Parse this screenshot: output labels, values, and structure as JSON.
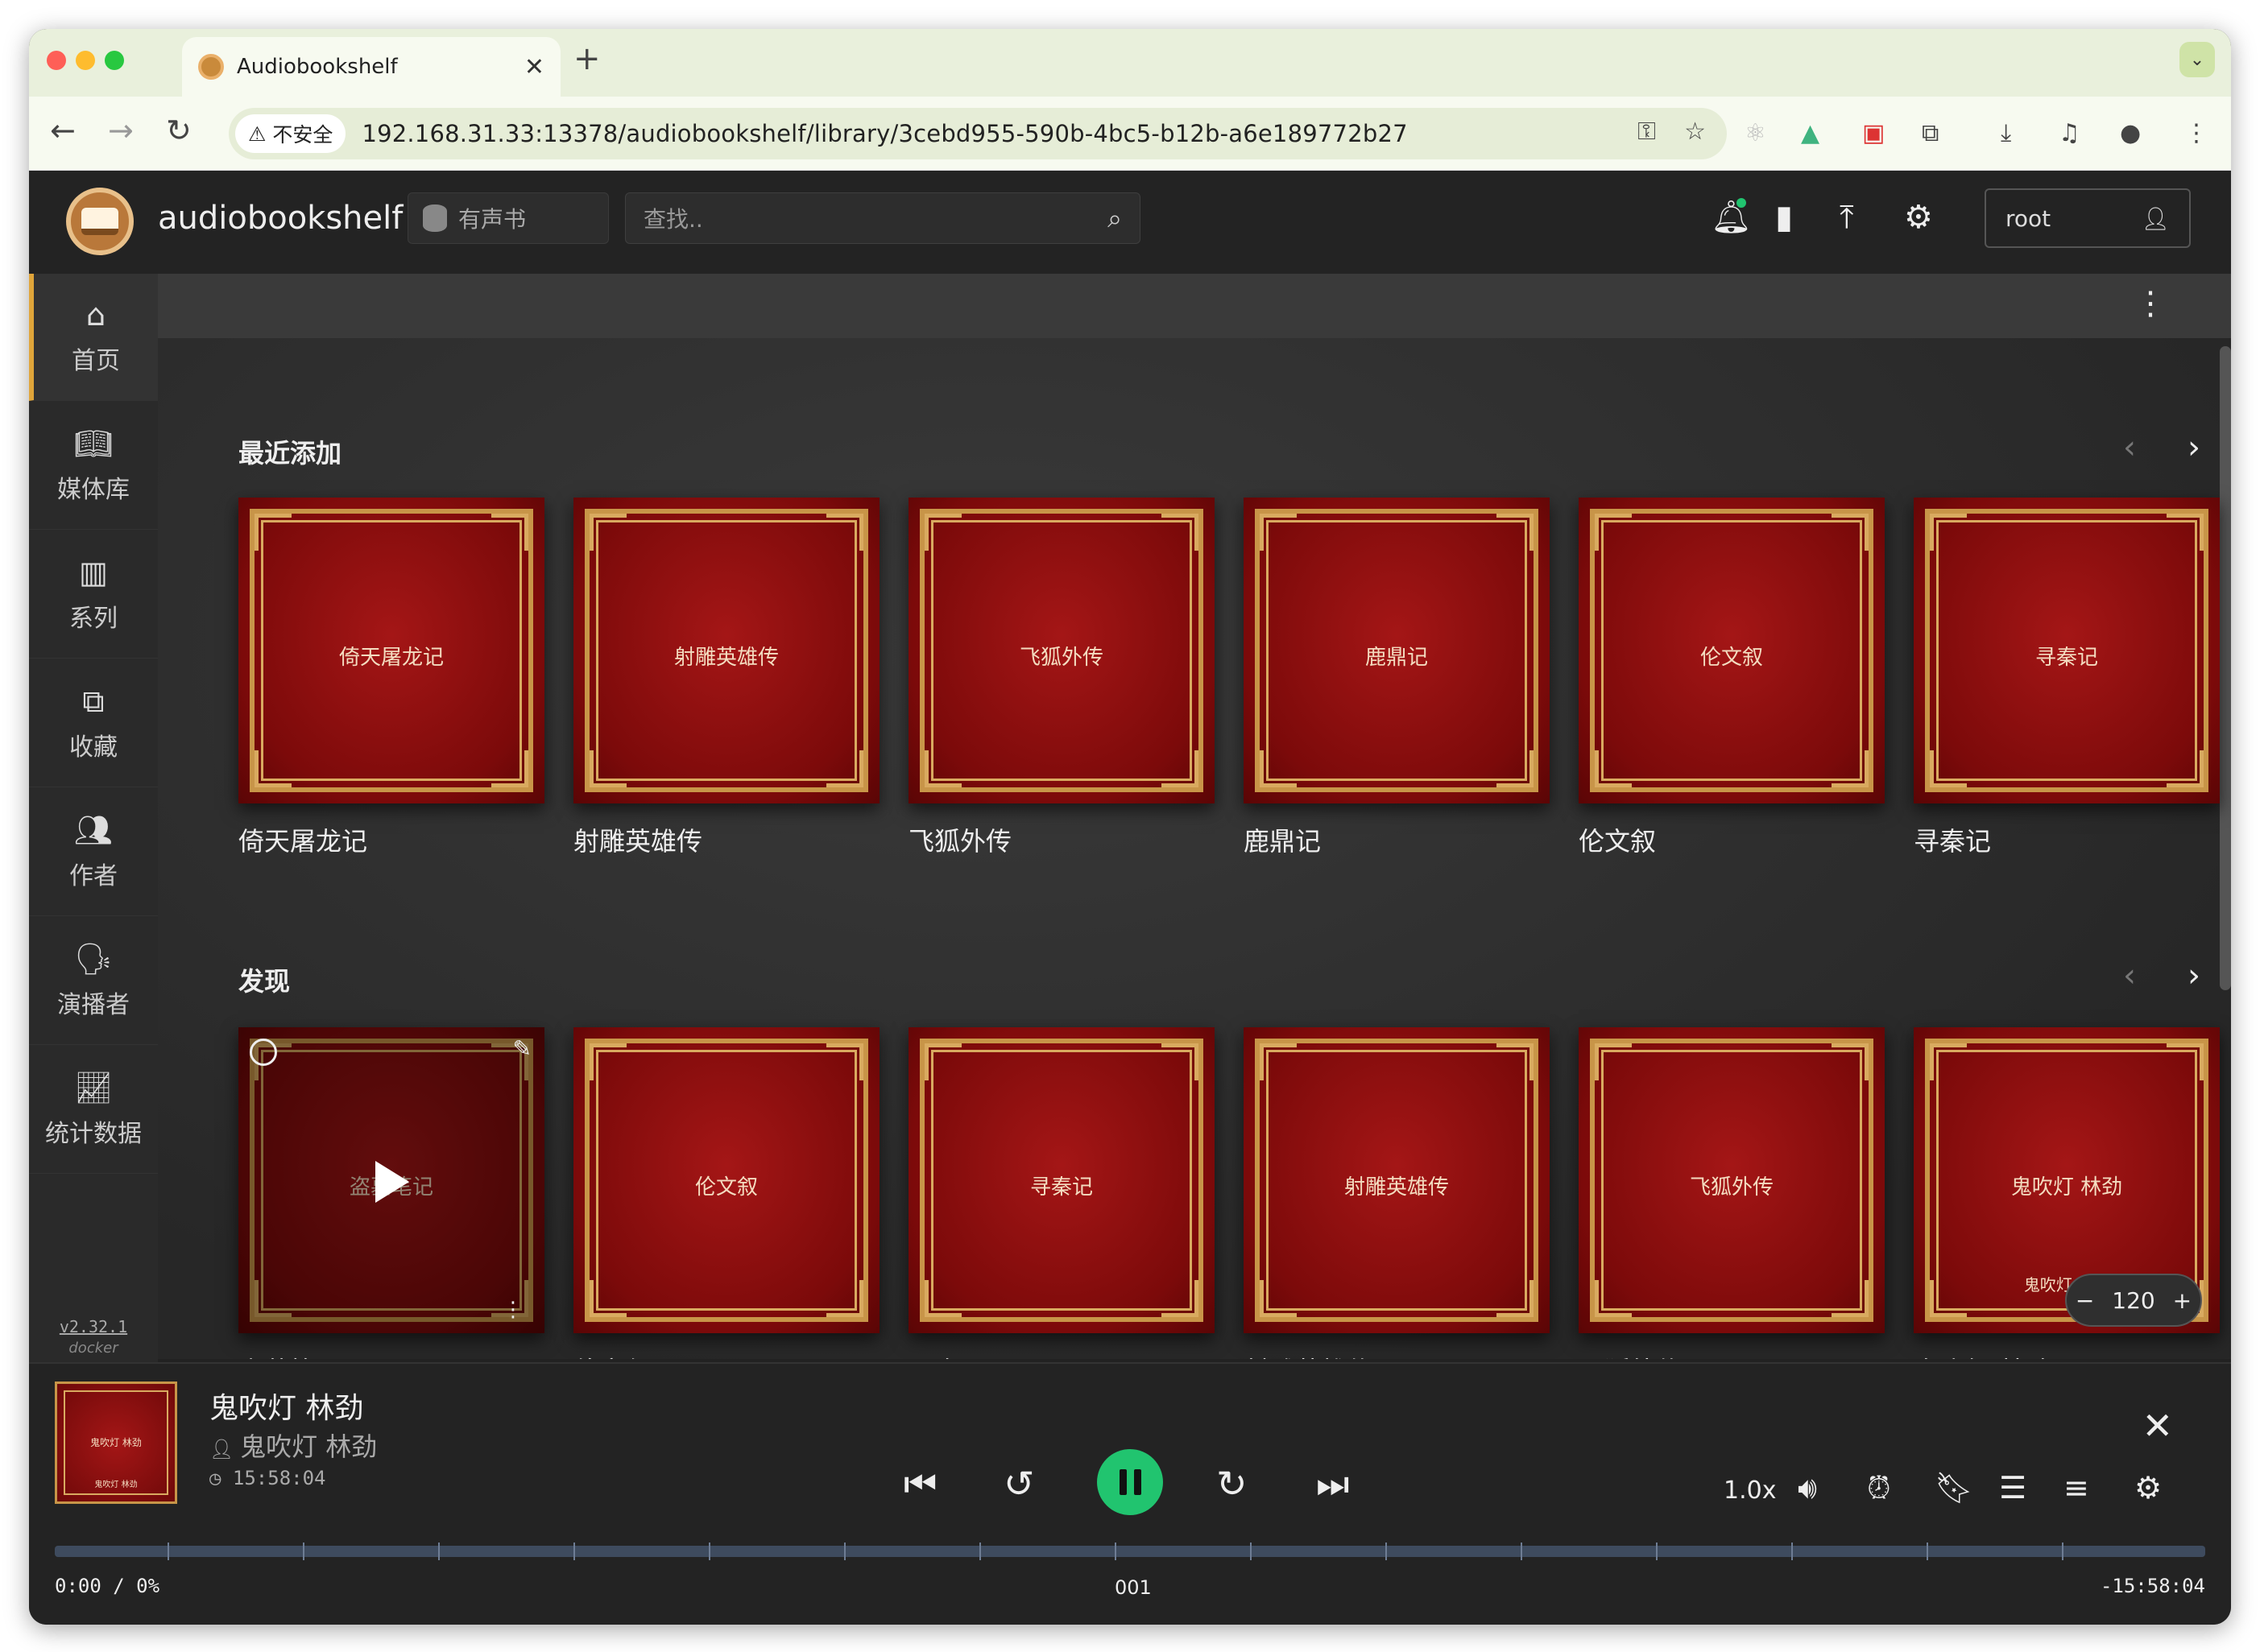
{
  "browser": {
    "tab_title": "Audiobookshelf",
    "new_tab": "+",
    "security_label": "不安全",
    "url": "192.168.31.33:13378/audiobookshelf/library/3cebd955-590b-4bc5-b12b-a6e189772b27"
  },
  "header": {
    "brand": "audiobookshelf",
    "library": "有声书",
    "search_placeholder": "查找..",
    "user": "root"
  },
  "sidebar": {
    "items": [
      {
        "label": "首页",
        "icon": "home-icon"
      },
      {
        "label": "媒体库",
        "icon": "book-open-icon"
      },
      {
        "label": "系列",
        "icon": "columns-icon"
      },
      {
        "label": "收藏",
        "icon": "collections-icon"
      },
      {
        "label": "作者",
        "icon": "users-icon"
      },
      {
        "label": "演播者",
        "icon": "narrator-icon"
      },
      {
        "label": "统计数据",
        "icon": "stats-icon"
      }
    ],
    "version": "v2.32.1",
    "install": "docker"
  },
  "shelves": [
    {
      "title": "最近添加",
      "books": [
        {
          "cover_text": "倚天屠龙记",
          "title": "倚天屠龙记"
        },
        {
          "cover_text": "射雕英雄传",
          "title": "射雕英雄传"
        },
        {
          "cover_text": "飞狐外传",
          "title": "飞狐外传"
        },
        {
          "cover_text": "鹿鼎记",
          "title": "鹿鼎记"
        },
        {
          "cover_text": "伦文叙",
          "title": "伦文叙"
        },
        {
          "cover_text": "寻秦记",
          "title": "寻秦记"
        }
      ]
    },
    {
      "title": "发现",
      "books": [
        {
          "cover_text": "盗墓笔记",
          "title": "盗墓笔记"
        },
        {
          "cover_text": "伦文叙",
          "title": "伦文叙"
        },
        {
          "cover_text": "寻秦记",
          "title": "寻秦记"
        },
        {
          "cover_text": "射雕英雄传",
          "title": "射雕英雄传"
        },
        {
          "cover_text": "飞狐外传",
          "title": "飞狐外传"
        },
        {
          "cover_text": "鬼吹灯 林劲",
          "cover_subtext": "鬼吹灯 林劲",
          "title": "鬼吹灯 林劲"
        }
      ]
    }
  ],
  "zoom": {
    "minus": "−",
    "value": "120",
    "plus": "+"
  },
  "player": {
    "cover_text": "鬼吹灯 林劲",
    "cover_subtext": "鬼吹灯 林劲",
    "title": "鬼吹灯 林劲",
    "author": "鬼吹灯 林劲",
    "duration": "15:58:04",
    "speed": "1.0x",
    "current": "0:00 / 0%",
    "chapter": "001",
    "remaining": "-15:58:04",
    "progress": 0
  },
  "colors": {
    "accent": "#21c46f",
    "active_marker": "#e0a53a",
    "cover": "#8b0f0f",
    "cover_border": "#c89548"
  }
}
